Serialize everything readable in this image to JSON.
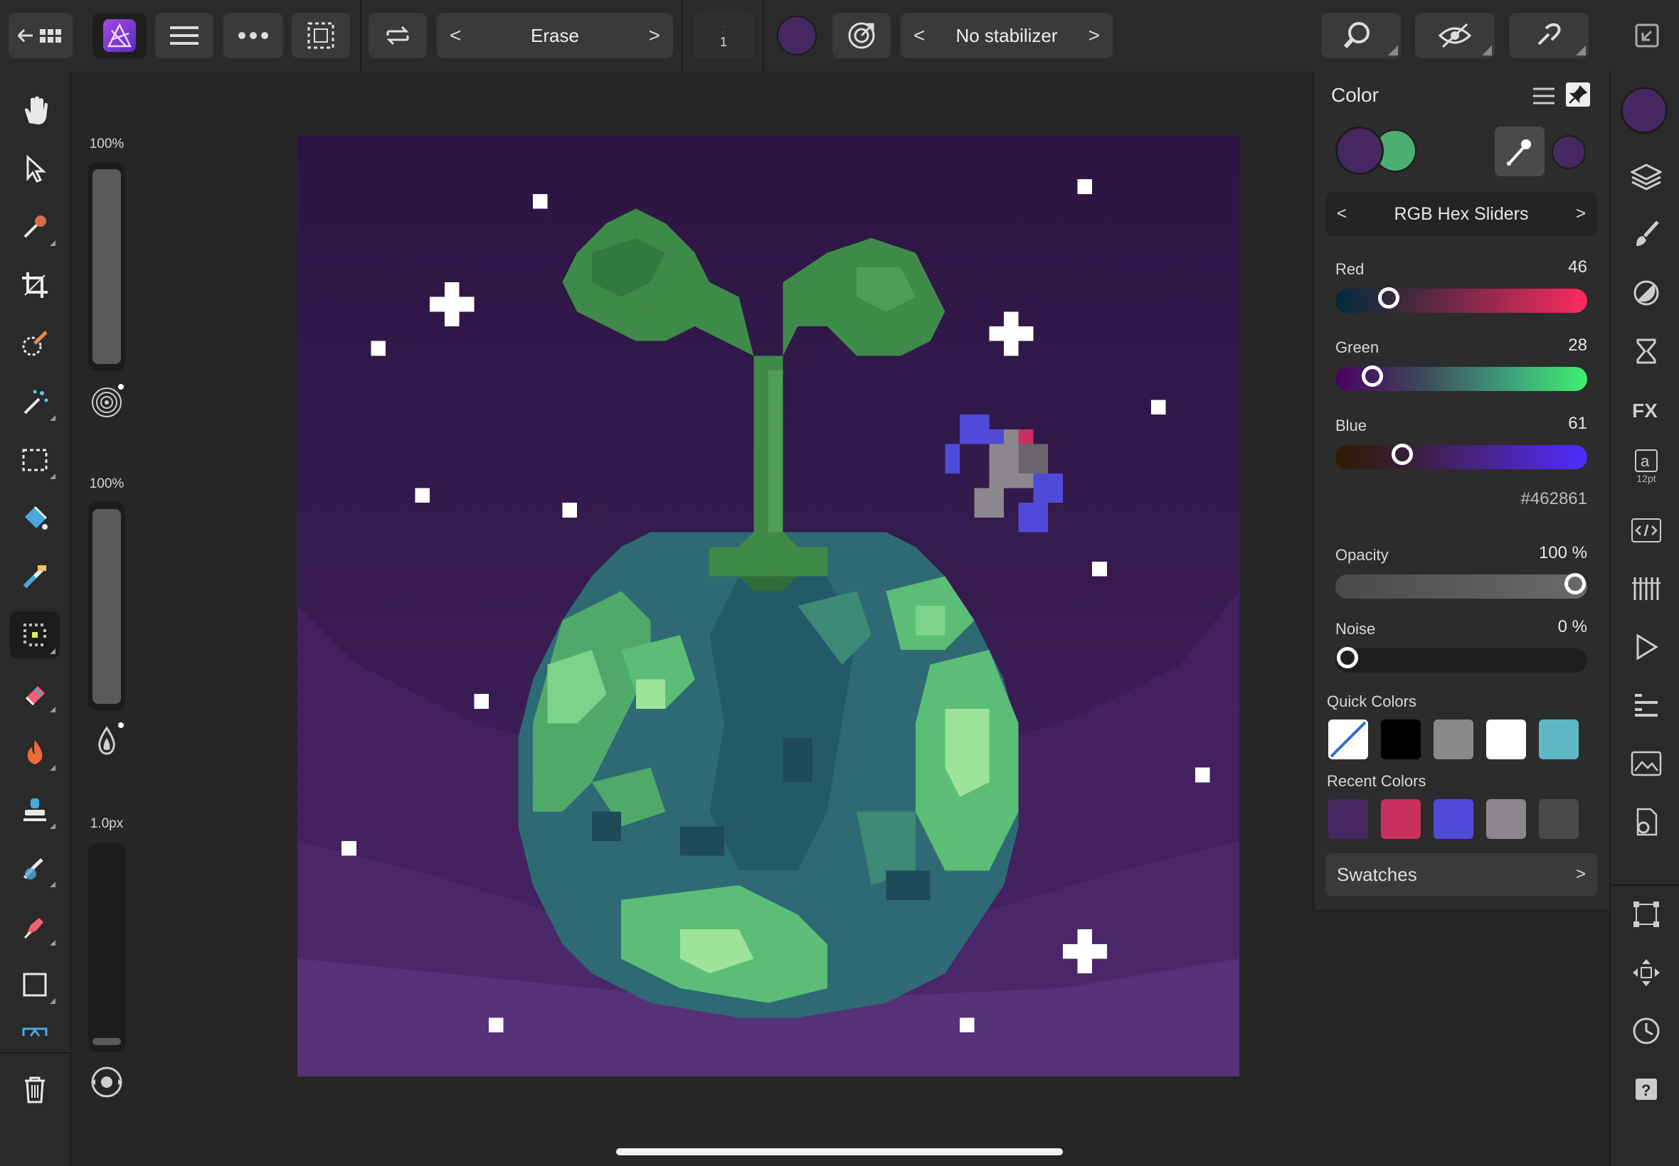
{
  "toolbar": {
    "brush_mode": {
      "label": "Erase"
    },
    "brush_width_value": "1",
    "stabilizer": {
      "label": "No stabilizer"
    },
    "current_color": "#462861"
  },
  "left_sliders": {
    "size_label": "100%",
    "opacity_label": "100%",
    "width_label": "1.0px"
  },
  "color_panel": {
    "title": "Color",
    "mode": "RGB Hex Sliders",
    "primary_color": "#462861",
    "secondary_color": "#4caf72",
    "red": {
      "label": "Red",
      "value": "46",
      "fraction": 0.18
    },
    "green": {
      "label": "Green",
      "value": "28",
      "fraction": 0.11
    },
    "blue": {
      "label": "Blue",
      "value": "61",
      "fraction": 0.24
    },
    "hex": "#462861",
    "opacity": {
      "label": "Opacity",
      "value": "100 %",
      "fraction": 1.0
    },
    "noise": {
      "label": "Noise",
      "value": "0 %",
      "fraction": 0.0
    },
    "quick_colors_label": "Quick Colors",
    "quick_colors": [
      "none",
      "#000000",
      "#8a8a8a",
      "#ffffff",
      "#5fb7c4"
    ],
    "recent_colors_label": "Recent Colors",
    "recent_colors": [
      "#462861",
      "#c9305f",
      "#4f4bd8",
      "#8c878c",
      "#4a4a4a"
    ],
    "swatches_label": "Swatches"
  },
  "right_strip": {
    "character_size": "12pt"
  }
}
